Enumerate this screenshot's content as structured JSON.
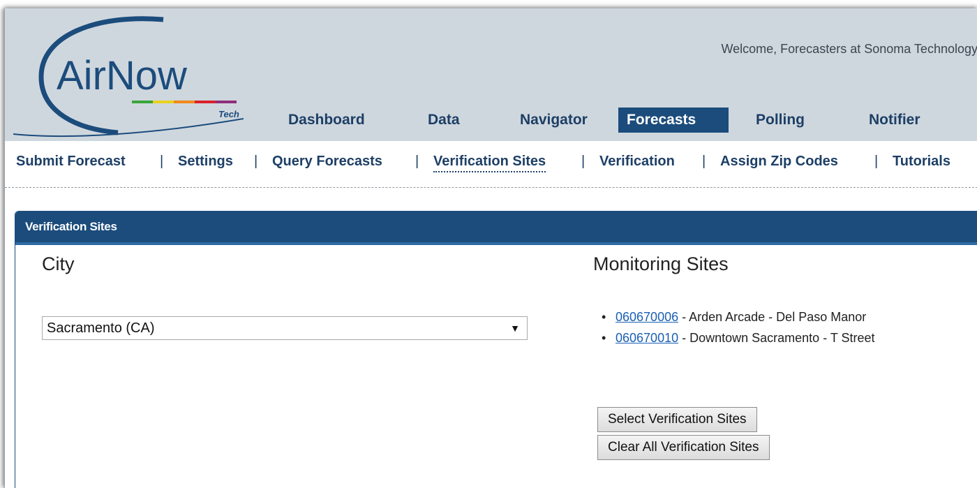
{
  "header": {
    "logo_text": "AirNow",
    "logo_subtext": "Tech",
    "welcome": "Welcome, Forecasters at Sonoma Technology"
  },
  "main_nav": [
    "Dashboard",
    "Data",
    "Navigator",
    "Forecasts",
    "Polling",
    "Notifier"
  ],
  "active_main_nav": "Forecasts",
  "sub_nav": [
    "Submit Forecast",
    "Settings",
    "Query Forecasts",
    "Verification Sites",
    "Verification",
    "Assign Zip Codes",
    "Tutorials"
  ],
  "sub_nav_separator": "|",
  "active_sub_nav": "Verification Sites",
  "panel": {
    "title": "Verification Sites",
    "city_label": "City",
    "city_selected": "Sacramento (CA)",
    "monitoring_label": "Monitoring Sites",
    "sites": [
      {
        "id": "060670006",
        "name": " - Arden Arcade - Del Paso Manor"
      },
      {
        "id": "060670010",
        "name": " - Downtown Sacramento - T Street"
      }
    ],
    "select_button": "Select Verification Sites",
    "clear_button": "Clear All Verification Sites"
  },
  "colors": {
    "header_bg": "#cfd7de",
    "nav_text": "#1d3f66",
    "active_bg": "#1b4c7c",
    "link": "#1a5fb4"
  }
}
